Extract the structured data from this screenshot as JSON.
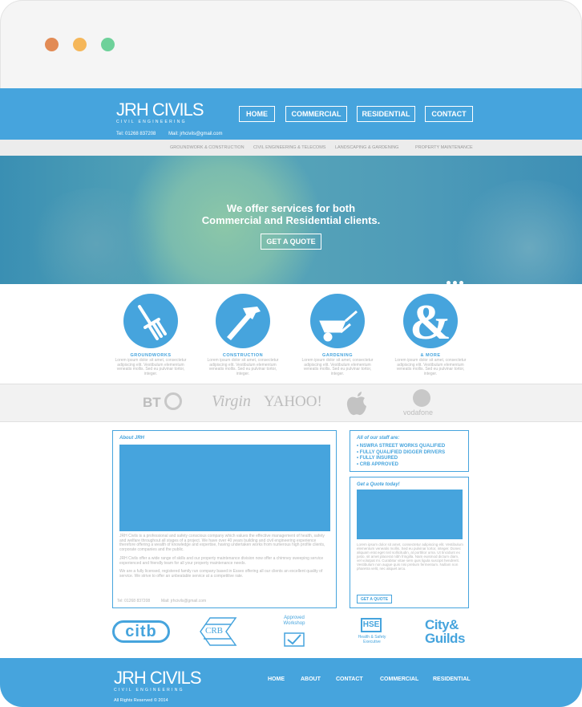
{
  "window": {
    "dots": [
      "#e28b55",
      "#f5b75a",
      "#6ed19a"
    ]
  },
  "header": {
    "logo": "JRH CIVILS",
    "logo_sub": "CIVIL ENGINEERING",
    "tel": "Tel: 01268 837208",
    "mail": "Mail: jrhcivils@gmail.com",
    "nav": [
      "HOME",
      "COMMERCIAL",
      "RESIDENTIAL",
      "CONTACT"
    ]
  },
  "subnav": [
    "GROUNDWORK & CONSTRUCTION",
    "CIVIL ENGINEERING & TELECOMS",
    "LANDSCAPING & GARDENING",
    "PROPERTY MAINTENANCE"
  ],
  "hero": {
    "line1": "We offer services for both",
    "line2": "Commercial and Residential clients.",
    "button": "GET A QUOTE"
  },
  "services": [
    {
      "label": "GROUNDWORKS",
      "icon": "fork-icon"
    },
    {
      "label": "CONSTRUCTION",
      "icon": "hammer-icon"
    },
    {
      "label": "GARDENING",
      "icon": "wheelbarrow-icon"
    },
    {
      "label": "& MORE",
      "icon": "ampersand-icon"
    }
  ],
  "service_text": "Lorem ipsum dolor sit amet, consectetur adipiscing elit. Vestibulum elementum veneatis mollis. Sed eu pulvinar tortor, integer.",
  "brands": [
    "BT",
    "Virgin",
    "YAHOO!",
    "apple",
    "vodafone"
  ],
  "about": {
    "title": "About JRH",
    "p1": "JRH Civils is a professional and safety conscious company which values the effective management of health, safety and welfare throughout all stages of a project. We have over 40 years building and civil engineering experience therefore offering a wealth of knowledge and expertise, having undertaken works from numerous high profile clients, corporate companies and the public.",
    "p2": "JRH Civils offer a wide range of skills and our property maintenance division now offer a chimney sweeping service experienced and friendly team for all your property maintenance needs.",
    "p3": "We are a fully licensed, registered family run company based in Essex offering all our clients an excellent quality of service. We strive to offer an unbeatable service at a competitive rate.",
    "tel": "Tel: 01268 837208",
    "mail": "Mail: jrhcivils@gmail.com"
  },
  "staff": {
    "title": "All of our staff are:",
    "items": [
      "NSWRA STREET WORKS QUALIFIED",
      "FULLY QUALIFIED DIGGER DRIVERS",
      "FULLY INSURED",
      "CRB APPROVED"
    ]
  },
  "quote": {
    "title": "Get a Quote today!",
    "text": "Lorem ipsum dolor sit amet, consectetur adipiscing elit. Vestibulum elementum veneatis mollis. Sed eu pulvinar tortor, integer. Donec aliquam erat eget nisl sollicitudin, at porttitor urna. Ut tincidunt ex justo, sit amet placerat nibh fringilla. Nam euismod dictum diam, vel volutpat mi. Curabitur vitae sem quis ligula suscipit hendrerit. Vestibulum non augue quis nisi pretium fermentum. Nullam non pharetra velit, nec aliquet arcu.",
    "button": "GET A QUOTE"
  },
  "partners": {
    "citb": "citb",
    "crb": "CRB",
    "workshop": "Approved Workshop",
    "hse": "HSE",
    "hse_sub": "Health & Safety Executive",
    "city": "City&",
    "guilds": "Guilds"
  },
  "footer": {
    "logo": "JRH CIVILS",
    "logo_sub": "CIVIL ENGINEERING",
    "links": [
      "HOME",
      "ABOUT",
      "CONTACT",
      "COMMERCIAL",
      "RESIDENTIAL"
    ],
    "copyright": "All Rights Reserved © 2014"
  },
  "colors": {
    "brand": "#46a4dd"
  }
}
